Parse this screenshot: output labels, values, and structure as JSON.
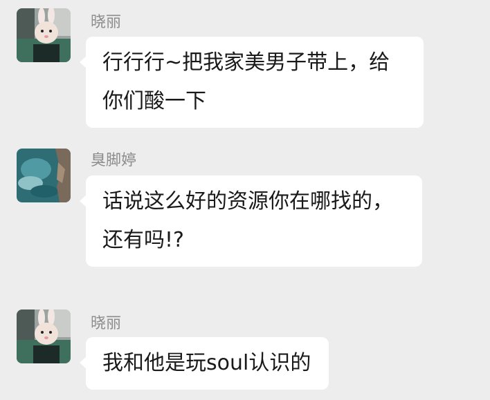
{
  "messages": [
    {
      "sender": "晓丽",
      "avatar": "bunny-avatar-icon",
      "text": "行行行~把我家美男子带上，给你们酸一下"
    },
    {
      "sender": "臭脚婷",
      "avatar": "sea-avatar-icon",
      "text": "话说这么好的资源你在哪找的，还有吗!?"
    },
    {
      "sender": "晓丽",
      "avatar": "bunny-avatar-icon",
      "text": "我和他是玩soul认识的"
    }
  ],
  "colors": {
    "background": "#ededed",
    "bubble": "#ffffff",
    "sender_name": "#8c8c8c",
    "text": "#191919"
  }
}
